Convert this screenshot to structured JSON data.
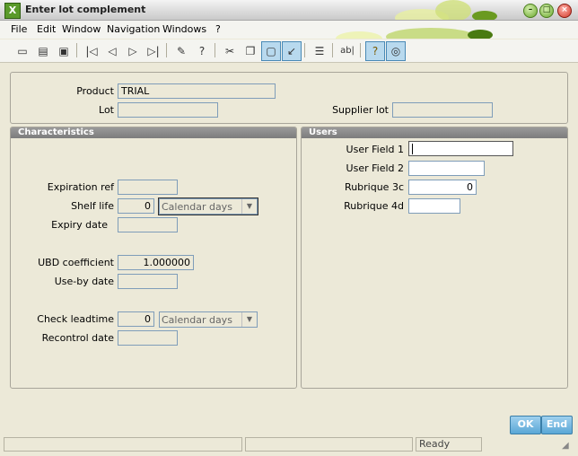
{
  "window": {
    "title": "Enter lot complement"
  },
  "menu": [
    {
      "label": "File"
    },
    {
      "label": "Edit"
    },
    {
      "label": "Window"
    },
    {
      "label": "Navigation"
    },
    {
      "label": "Windows"
    },
    {
      "label": "?"
    }
  ],
  "toolbar": {
    "icons": [
      "new-icon",
      "print-icon",
      "print-preview-icon",
      "first-record-icon",
      "previous-record-icon",
      "next-record-icon",
      "last-record-icon",
      "attach-icon",
      "help-icon",
      "tools-icon",
      "copy-icon",
      "window-icon",
      "export-icon",
      "form-icon",
      "text-field-icon",
      "question-icon",
      "zoom-icon"
    ],
    "text_field_glyph": "ab|"
  },
  "header_form": {
    "product_label": "Product",
    "product_value": "TRIAL",
    "lot_label": "Lot",
    "lot_value": "",
    "supplier_lot_label": "Supplier lot",
    "supplier_lot_value": ""
  },
  "characteristics": {
    "title": "Characteristics",
    "expiration_ref_label": "Expiration ref",
    "expiration_ref_value": "",
    "shelf_life_label": "Shelf life",
    "shelf_life_value": "0",
    "shelf_life_unit": "Calendar days",
    "expiry_date_label": "Expiry date",
    "expiry_date_value": "",
    "ubd_coefficient_label": "UBD coefficient",
    "ubd_coefficient_value": "1.000000",
    "use_by_date_label": "Use-by date",
    "use_by_date_value": "",
    "check_leadtime_label": "Check leadtime",
    "check_leadtime_value": "0",
    "check_leadtime_unit": "Calendar days",
    "recontrol_date_label": "Recontrol date",
    "recontrol_date_value": ""
  },
  "users": {
    "title": "Users",
    "user_field_1_label": "User Field 1",
    "user_field_1_value": "",
    "user_field_2_label": "User Field 2",
    "user_field_2_value": "",
    "rubrique_3c_label": "Rubrique 3c",
    "rubrique_3c_value": "0",
    "rubrique_4d_label": "Rubrique 4d",
    "rubrique_4d_value": ""
  },
  "buttons": {
    "ok_label": "OK",
    "end_label": "End"
  },
  "status": {
    "field1": "",
    "field2": "",
    "state": "Ready"
  },
  "colors": {
    "accent": "#5aa7d6",
    "panel_header": "#8a8a8a",
    "title_icon": "#5a9a2a"
  }
}
